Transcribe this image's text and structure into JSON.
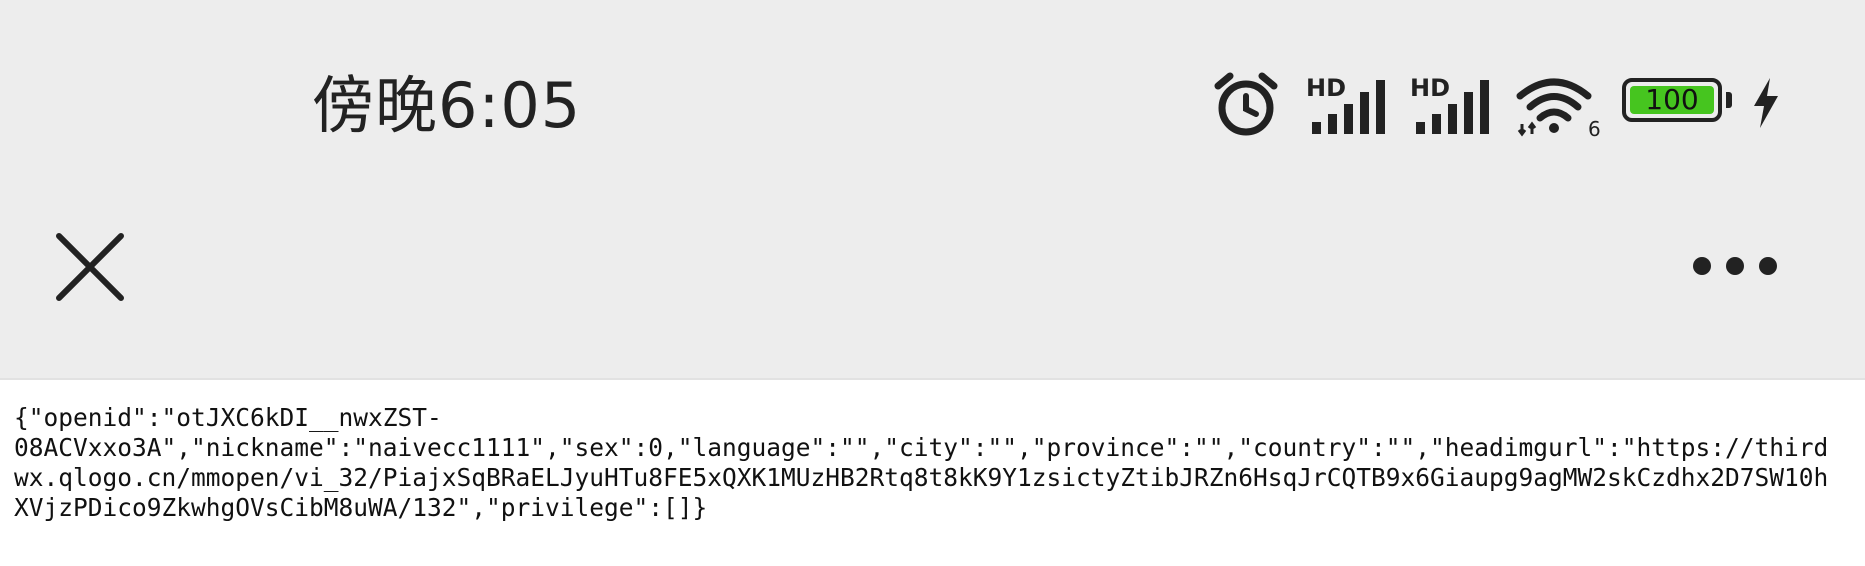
{
  "status_bar": {
    "time": "傍晚6:05",
    "battery_level": "100",
    "signal_label_1": "HD",
    "signal_label_2": "HD",
    "wifi_label": "6",
    "icons": [
      "alarm-icon",
      "signal-icon",
      "signal-icon",
      "wifi-icon",
      "battery-icon",
      "charging-bolt-icon"
    ]
  },
  "nav_bar": {
    "close_icon": "close-icon",
    "more_icon": "more-dots-icon"
  },
  "content": {
    "line1": "{\"openid\":\"otJXC6kDI__nwxZST-",
    "line2": "08ACVxxo3A\",\"nickname\":\"naivecc1111\",\"sex\":0,\"language\":\"\",\"city\":\"\",\"province\":\"\",\"country\":\"\",\"headimgurl\":\"https://third",
    "line3": "wx.qlogo.cn/mmopen/vi_32/PiajxSqBRaELJyuHTu8FE5xQXK1MUzHB2Rtq8t8kK9Y1zsictyZtibJRZn6HsqJrCQTB9x6Giaupg9agMW2skCzdhx2D7SW10h",
    "line4": "XVjzPDico9ZkwhgOVsCibM8uWA/132\",\"privilege\":[]}"
  },
  "colors": {
    "bar_background": "#ededed",
    "battery_fill": "#46c51f",
    "text": "#111111"
  }
}
